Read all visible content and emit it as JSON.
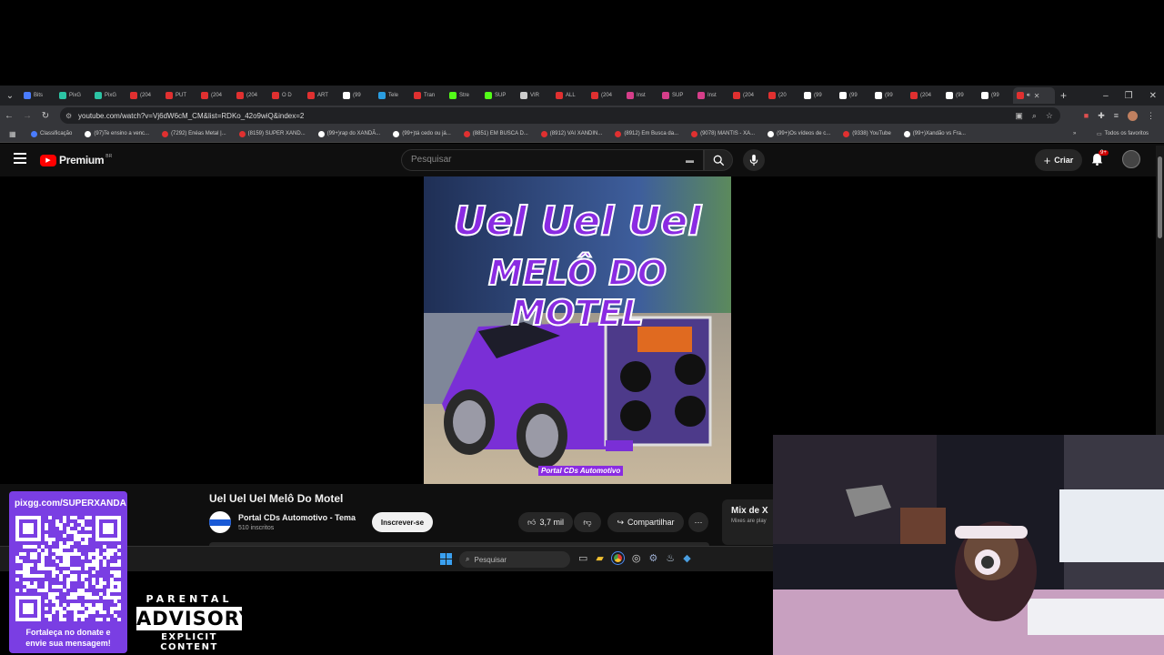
{
  "browser": {
    "tabs": [
      {
        "label": "Bits",
        "color": "#4a7cff"
      },
      {
        "label": "PixG",
        "color": "#2cc4a4"
      },
      {
        "label": "PixG",
        "color": "#2cc4a4"
      },
      {
        "label": "(204",
        "color": "#e03030"
      },
      {
        "label": "PUT",
        "color": "#e03030"
      },
      {
        "label": "(204",
        "color": "#e03030"
      },
      {
        "label": "(204",
        "color": "#e03030"
      },
      {
        "label": "O D",
        "color": "#e03030"
      },
      {
        "label": "ART",
        "color": "#e03030"
      },
      {
        "label": "(99",
        "color": "#ffffff"
      },
      {
        "label": "Tele",
        "color": "#2a9de0"
      },
      {
        "label": "Tran",
        "color": "#e03030"
      },
      {
        "label": "Stre",
        "color": "#53fc18"
      },
      {
        "label": "SUP",
        "color": "#53fc18"
      },
      {
        "label": "VIR",
        "color": "#cccccc"
      },
      {
        "label": "ALL",
        "color": "#e03030"
      },
      {
        "label": "(204",
        "color": "#e03030"
      },
      {
        "label": "Inst",
        "color": "#d63e8a"
      },
      {
        "label": "SUP",
        "color": "#d63e8a"
      },
      {
        "label": "Inst",
        "color": "#d63e8a"
      },
      {
        "label": "(204",
        "color": "#e03030"
      },
      {
        "label": "(20",
        "color": "#e03030"
      },
      {
        "label": "(99",
        "color": "#ffffff"
      },
      {
        "label": "(99",
        "color": "#ffffff"
      },
      {
        "label": "(99",
        "color": "#ffffff"
      },
      {
        "label": "(204",
        "color": "#e03030"
      },
      {
        "label": "(99",
        "color": "#ffffff"
      },
      {
        "label": "(99",
        "color": "#ffffff"
      }
    ],
    "url": "youtube.com/watch?v=Vj6dW6cM_CM&list=RDKo_42o9wiQ&index=2",
    "bookmarks": [
      {
        "label": "Classificação",
        "color": "#4a7cff"
      },
      {
        "label": "(97)Te ensino a venc...",
        "color": "#ffffff"
      },
      {
        "label": "(7292) Enéas Metal |...",
        "color": "#e03030"
      },
      {
        "label": "(8159) SUPER XAND...",
        "color": "#e03030"
      },
      {
        "label": "(99+)rap do XANDÃ...",
        "color": "#ffffff"
      },
      {
        "label": "(99+)tá cedo ou já...",
        "color": "#ffffff"
      },
      {
        "label": "(8851) EM BUSCA D...",
        "color": "#e03030"
      },
      {
        "label": "(8912) VAI XANDIN...",
        "color": "#e03030"
      },
      {
        "label": "(8912) Em Busca da...",
        "color": "#e03030"
      },
      {
        "label": "(9078) MANTIS - XA...",
        "color": "#e03030"
      },
      {
        "label": "(99+)Os vídeos de c...",
        "color": "#ffffff"
      },
      {
        "label": "(9338) YouTube",
        "color": "#e03030"
      },
      {
        "label": "(99+)Xandão vs Fra...",
        "color": "#ffffff"
      }
    ],
    "all_favorites": "Todos os favoritos"
  },
  "youtube": {
    "logo_text": "Premium",
    "logo_region": "BR",
    "search_placeholder": "Pesquisar",
    "create_label": "Criar",
    "notif_count": "9+",
    "thumbnail": {
      "line1": "Uel Uel Uel",
      "line2": "MELÔ DO MOTEL",
      "brand": "Portal CDs Automotivo"
    },
    "video": {
      "title": "Uel Uel Uel Melô Do Motel",
      "channel": "Portal CDs Automotivo - Tema",
      "subscribers": "510 inscritos",
      "subscribe_label": "Inscrever-se",
      "likes": "3,7 mil",
      "share_label": "Compartilhar"
    },
    "mix": {
      "title": "Mix de X",
      "subtitle": "Mixes are play"
    }
  },
  "taskbar": {
    "search_placeholder": "Pesquisar"
  },
  "overlay": {
    "qr_url": "pixgg.com/SUPERXANDA",
    "qr_caption": "Fortaleça no donate e envie sua mensagem!",
    "advisory_top": "PARENTAL",
    "advisory_mid": "ADVISORY",
    "advisory_bottom": "EXPLICIT CONTENT"
  }
}
